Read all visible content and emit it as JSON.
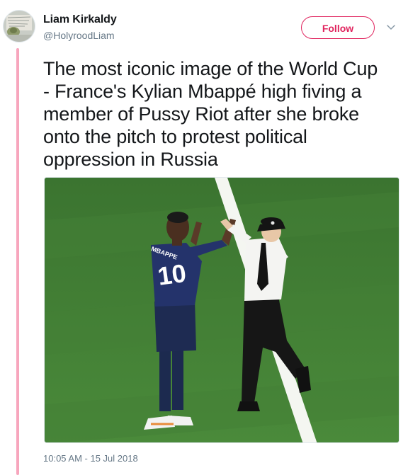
{
  "tweet": {
    "author_name": "Liam Kirkaldy",
    "author_handle": "@HolyroodLiam",
    "follow_label": "Follow",
    "text": "The most iconic image of the World Cup\n- France's Kylian Mbappé high fiving a\nmember of Pussy Riot after she broke\nonto the pitch to protest political\noppression in Russia",
    "timestamp": "10:05 AM - 15 Jul 2018",
    "jersey_name": "MBAPPE",
    "jersey_number": "10"
  },
  "colors": {
    "accent": "#e0245e",
    "thread_line": "#f7a6bd",
    "text_primary": "#14171a",
    "text_secondary": "#657786",
    "pitch_green": "#3f7a33"
  },
  "icons": {
    "caret": "chevron-down-icon",
    "avatar": "profile-avatar"
  }
}
